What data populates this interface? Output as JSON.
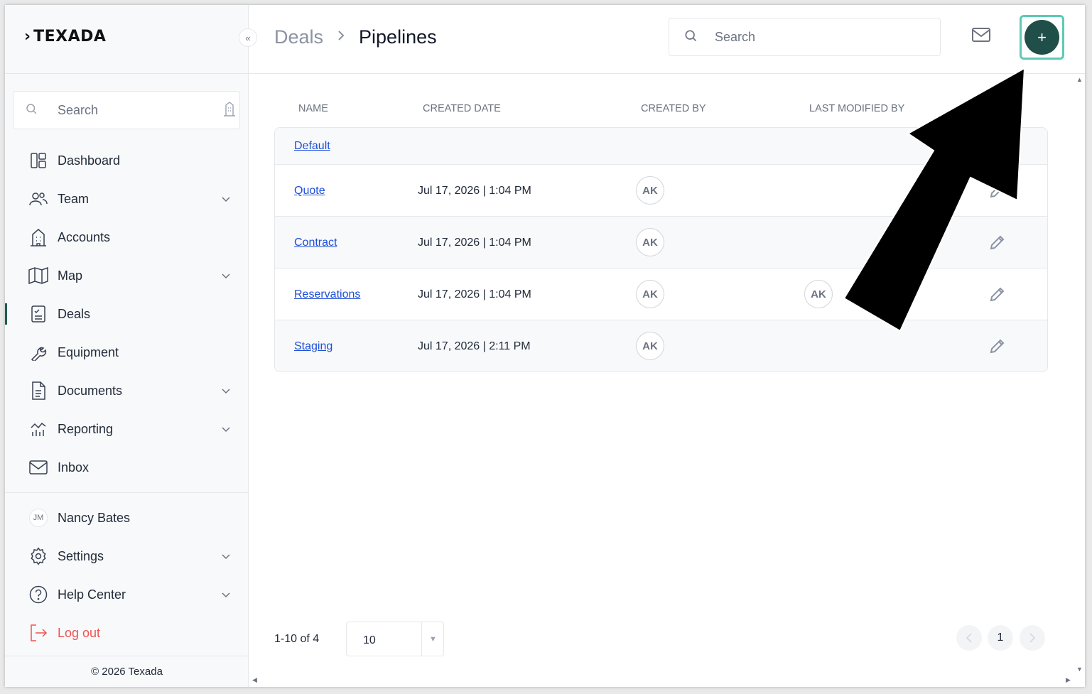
{
  "brand": {
    "name": "TEXADA"
  },
  "sidebar": {
    "search_placeholder": "Search",
    "items": [
      {
        "label": "Dashboard",
        "icon": "dashboard-icon",
        "has_chevron": false
      },
      {
        "label": "Team",
        "icon": "team-icon",
        "has_chevron": true
      },
      {
        "label": "Accounts",
        "icon": "building-icon",
        "has_chevron": false
      },
      {
        "label": "Map",
        "icon": "map-icon",
        "has_chevron": true
      },
      {
        "label": "Deals",
        "icon": "deals-icon",
        "has_chevron": false,
        "active": true
      },
      {
        "label": "Equipment",
        "icon": "wrench-icon",
        "has_chevron": false
      },
      {
        "label": "Documents",
        "icon": "document-icon",
        "has_chevron": true
      },
      {
        "label": "Reporting",
        "icon": "reporting-icon",
        "has_chevron": true
      },
      {
        "label": "Inbox",
        "icon": "mail-icon",
        "has_chevron": false
      }
    ],
    "user": {
      "initials": "JM",
      "name": "Nancy Bates"
    },
    "settings_label": "Settings",
    "help_label": "Help Center",
    "logout_label": "Log out",
    "copyright": "© 2026 Texada"
  },
  "header": {
    "breadcrumb_parent": "Deals",
    "breadcrumb_current": "Pipelines",
    "search_placeholder": "Search",
    "add_label": "+"
  },
  "table": {
    "columns": [
      "NAME",
      "CREATED DATE",
      "CREATED BY",
      "LAST MODIFIED BY"
    ],
    "rows": [
      {
        "name": "Default",
        "date": "",
        "created_by": "",
        "modified_by": ""
      },
      {
        "name": "Quote",
        "date": "Jul 17, 2026 | 1:04 PM",
        "created_by": "AK",
        "modified_by": ""
      },
      {
        "name": "Contract",
        "date": "Jul 17, 2026 | 1:04 PM",
        "created_by": "AK",
        "modified_by": ""
      },
      {
        "name": "Reservations",
        "date": "Jul 17, 2026 | 1:04 PM",
        "created_by": "AK",
        "modified_by": "AK"
      },
      {
        "name": "Staging",
        "date": "Jul 17, 2026 | 2:11 PM",
        "created_by": "AK",
        "modified_by": ""
      }
    ]
  },
  "pagination": {
    "range": "1-10 of 4",
    "page_size": "10",
    "current_page": "1"
  },
  "colors": {
    "accent": "#1f4f48",
    "highlight": "#5cc9b6",
    "link": "#1d4ed8",
    "logout": "#ef5350"
  }
}
